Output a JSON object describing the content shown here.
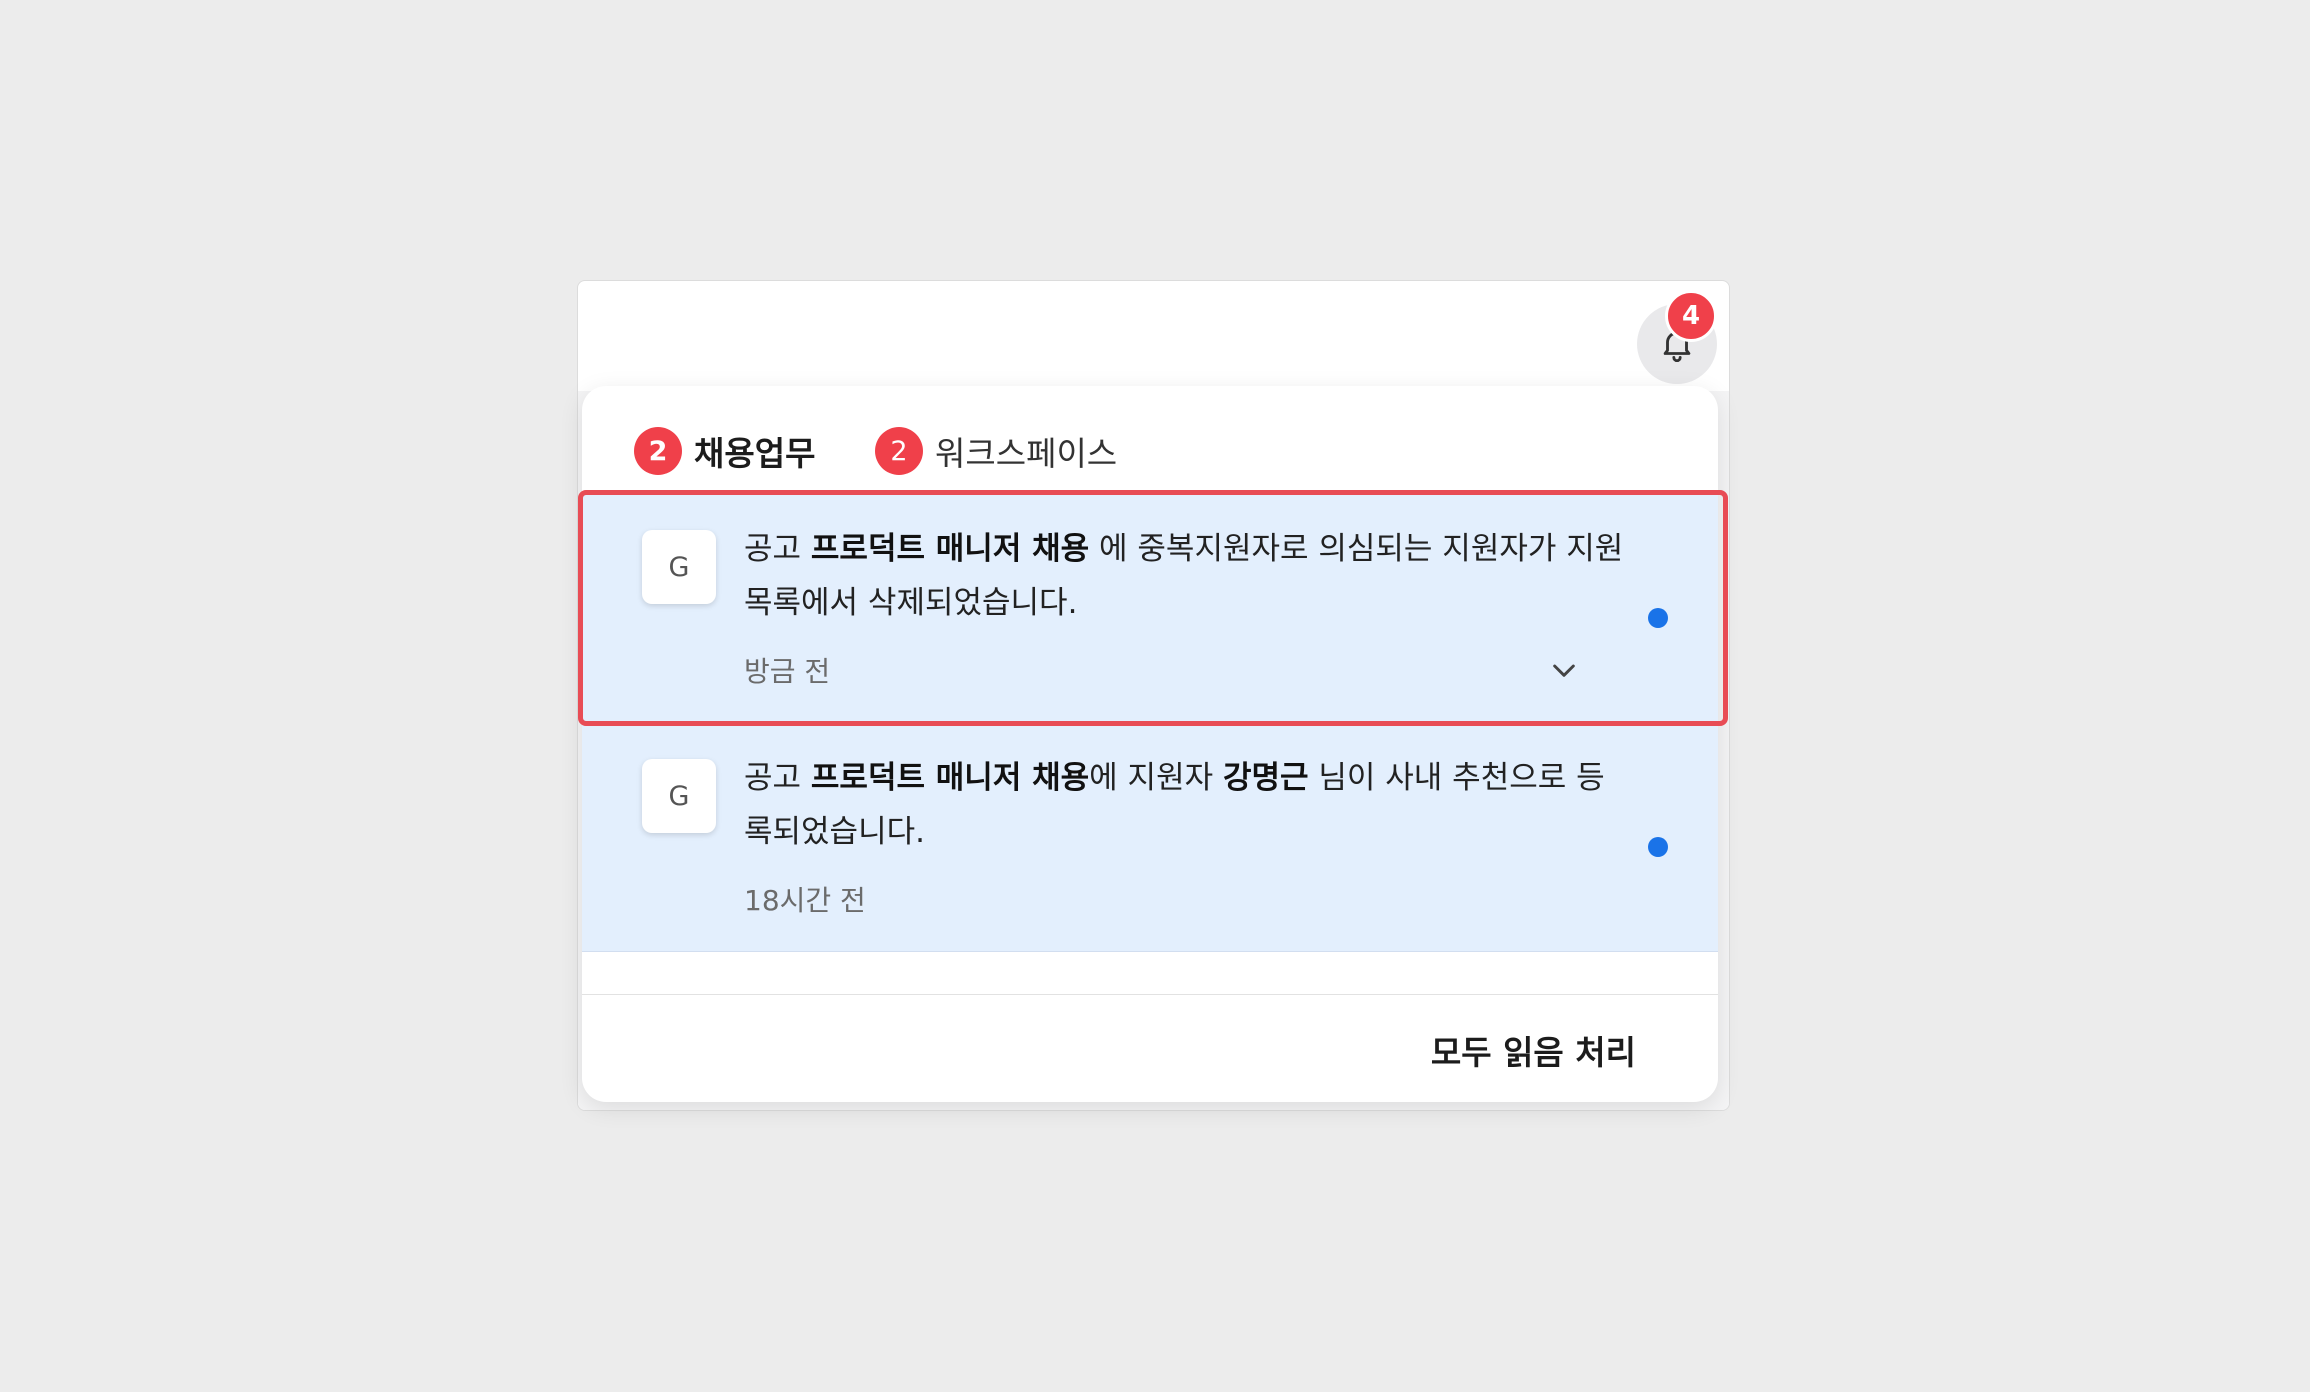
{
  "header": {
    "notification_count": "4",
    "bell_icon": "bell-icon"
  },
  "tabs": [
    {
      "count": "2",
      "label": "채용업무",
      "active": true
    },
    {
      "count": "2",
      "label": "워크스페이스",
      "active": false
    }
  ],
  "notifications": [
    {
      "avatar": "G",
      "text": {
        "part1": "공고 ",
        "bold1": "프로덕트 매니저 채용",
        "part2": " 에 중복지원자로 의심되는 지원자가 지원목록에서 삭제되었습니다."
      },
      "time": "방금 전",
      "unread": true,
      "expand_icon": "chevron-down-icon"
    },
    {
      "avatar": "G",
      "text": {
        "part1": "공고 ",
        "bold1": "프로덕트 매니저 채용",
        "part2": "에 지원자 ",
        "bold2": "강명근",
        "part3": " 님이 사내 추천으로 등록되었습니다."
      },
      "time": "18시간 전",
      "unread": true
    }
  ],
  "footer": {
    "mark_all_read": "모두 읽음 처리"
  },
  "colors": {
    "badge": "#f0404a",
    "unread_bg": "#e3effd",
    "unread_dot": "#1a73e8",
    "highlight": "#e84c55",
    "tab_underline": "#4a4fd8"
  }
}
